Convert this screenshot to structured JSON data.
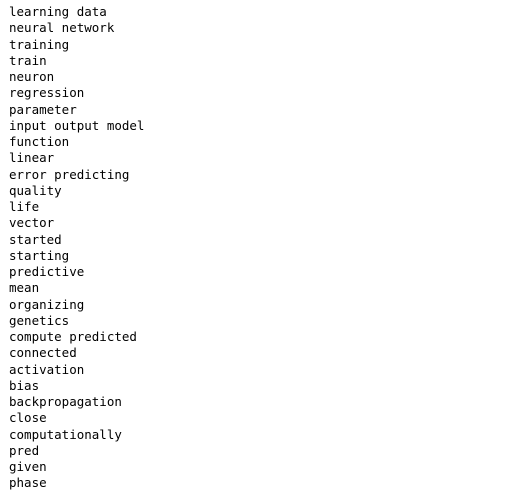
{
  "output": {
    "lines": [
      "learning data",
      "neural network",
      "training",
      "train",
      "neuron",
      "regression",
      "parameter",
      "input output model",
      "function",
      "linear",
      "error predicting",
      "quality",
      "life",
      "vector",
      "started",
      "starting",
      "predictive",
      "mean",
      "organizing",
      "genetics",
      "compute predicted",
      "connected",
      "activation",
      "bias",
      "backpropagation",
      "close",
      "computationally",
      "pred",
      "given",
      "phase"
    ]
  }
}
